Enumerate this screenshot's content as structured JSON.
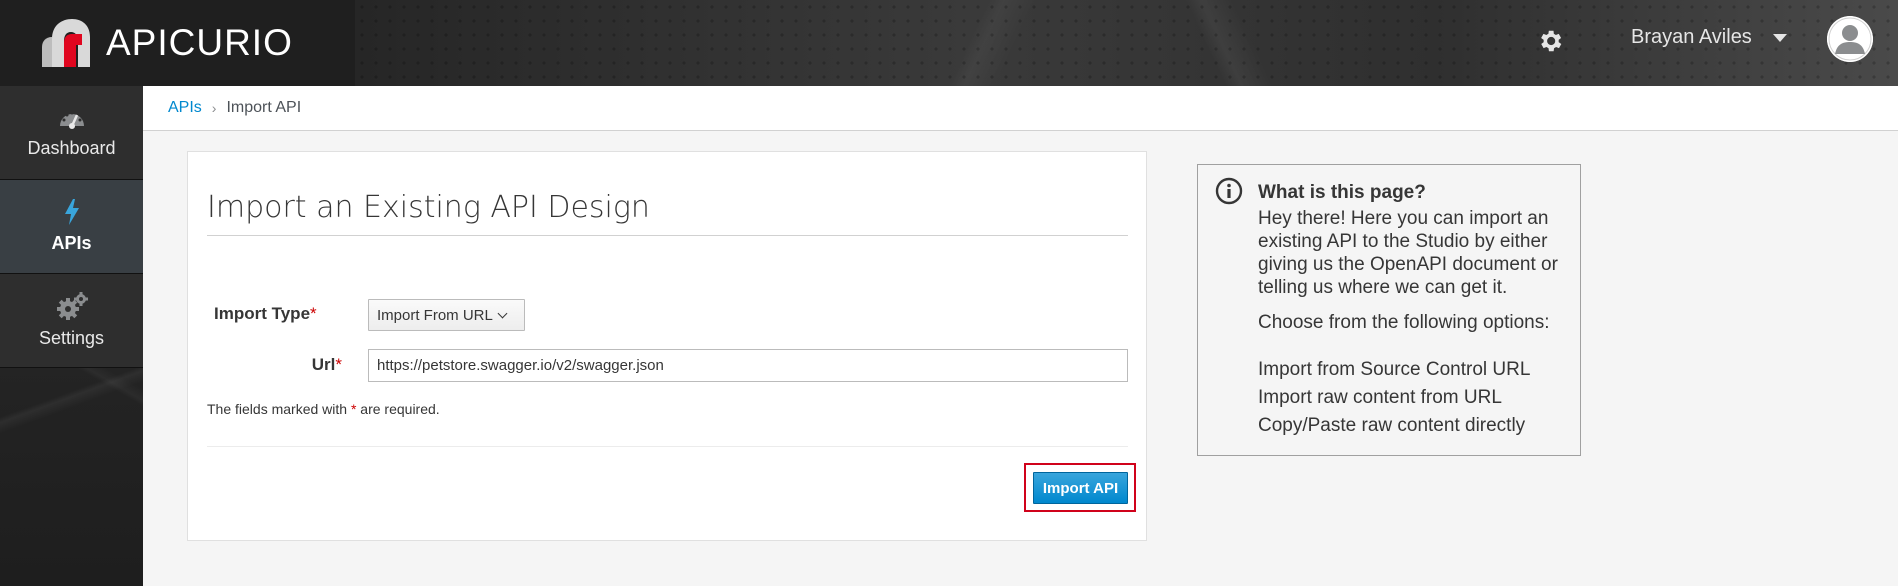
{
  "header": {
    "brand": "APICURIO",
    "user_name": "Brayan Aviles",
    "icons": [
      "apicurio-logo-icon",
      "gear-icon",
      "caret-down-icon",
      "user-avatar-icon"
    ]
  },
  "sidebar": {
    "items": [
      {
        "label": "Dashboard",
        "icon": "dashboard-gauge-icon",
        "active": false
      },
      {
        "label": "APIs",
        "icon": "bolt-icon",
        "active": true
      },
      {
        "label": "Settings",
        "icon": "cogs-icon",
        "active": false
      }
    ]
  },
  "breadcrumb": {
    "parent": "APIs",
    "separator": "›",
    "current": "Import API"
  },
  "form": {
    "title": "Import an Existing API Design",
    "import_type_label": "Import Type",
    "import_type_value": "Import From URL",
    "url_label": "Url",
    "url_value": "https://petstore.swagger.io/v2/swagger.json",
    "required_marker": "*",
    "help_prefix": "The fields marked with ",
    "help_suffix": " are required.",
    "submit_label": "Import API"
  },
  "info": {
    "heading": "What is this page?",
    "body": "Hey there! Here you can import an existing API to the Studio by either giving us the OpenAPI document or telling us where we can get it.",
    "choose": "Choose from the following options:",
    "options": [
      "Import from Source Control URL",
      "Import raw content from URL",
      "Copy/Paste raw content directly"
    ]
  },
  "colors": {
    "primary": "#0088ce",
    "highlight_border": "#d0021b",
    "required": "#cc0000",
    "sidebar_active": "#393f44"
  }
}
